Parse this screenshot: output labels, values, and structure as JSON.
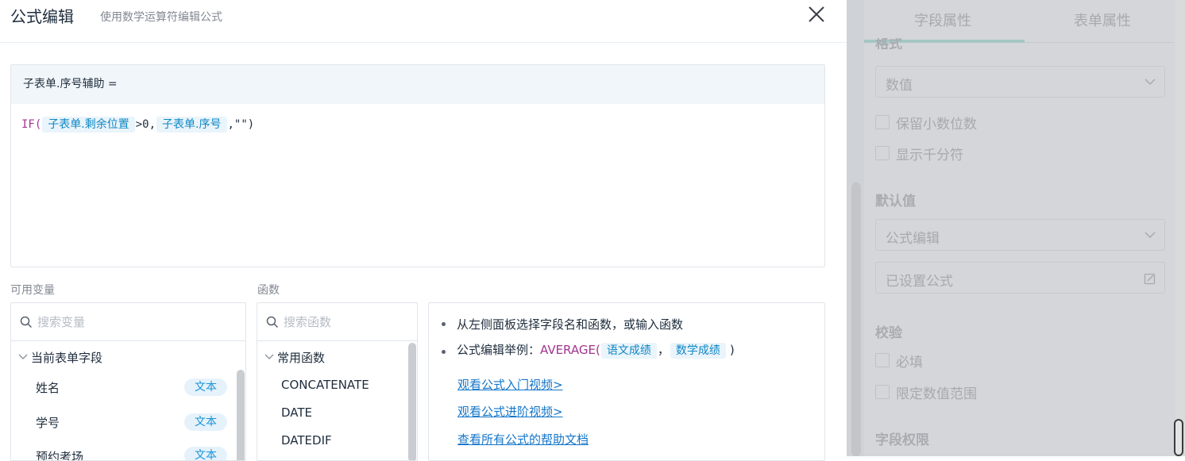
{
  "header": {
    "title": "公式编辑",
    "subtitle": "使用数学运算符编辑公式"
  },
  "editor": {
    "target_field": "子表单.序号辅助 =",
    "formula": {
      "func": "IF(",
      "token1": "子表单.剩余位置",
      "op": ">0,",
      "token2": "子表单.序号",
      "tail": ",\"\")"
    }
  },
  "variables": {
    "label": "可用变量",
    "search_placeholder": "搜索变量",
    "group": "当前表单字段",
    "items": [
      {
        "name": "姓名",
        "type": "文本"
      },
      {
        "name": "学号",
        "type": "文本"
      },
      {
        "name": "预约考场",
        "type": "文本"
      }
    ]
  },
  "functions": {
    "label": "函数",
    "search_placeholder": "搜索函数",
    "group": "常用函数",
    "items": [
      "CONCATENATE",
      "DATE",
      "DATEDIF"
    ]
  },
  "help": {
    "tip1": "从左侧面板选择字段名和函数，或输入函数",
    "tip2_prefix": "公式编辑举例：",
    "tip2_func": "AVERAGE(",
    "tip2_arg1": "语文成绩",
    "tip2_sep": "，",
    "tip2_arg2": "数学成绩",
    "tip2_close": ")",
    "links": [
      "观看公式入门视频>",
      "观看公式进阶视频>",
      "查看所有公式的帮助文档"
    ]
  },
  "right_panel": {
    "tabs": [
      "字段属性",
      "表单属性"
    ],
    "format_label": "格式",
    "format_value": "数值",
    "checks_format": [
      "保留小数位数",
      "显示千分符"
    ],
    "default_label": "默认值",
    "default_select": "公式编辑",
    "default_formula_state": "已设置公式",
    "validate_label": "校验",
    "checks_validate": [
      "必填",
      "限定数值范围"
    ],
    "perm_label": "字段权限"
  },
  "colors": {
    "accent": "#0d87c5",
    "function": "#a2358f",
    "link": "#1476c9",
    "badge_bg": "#e6f2fb"
  }
}
